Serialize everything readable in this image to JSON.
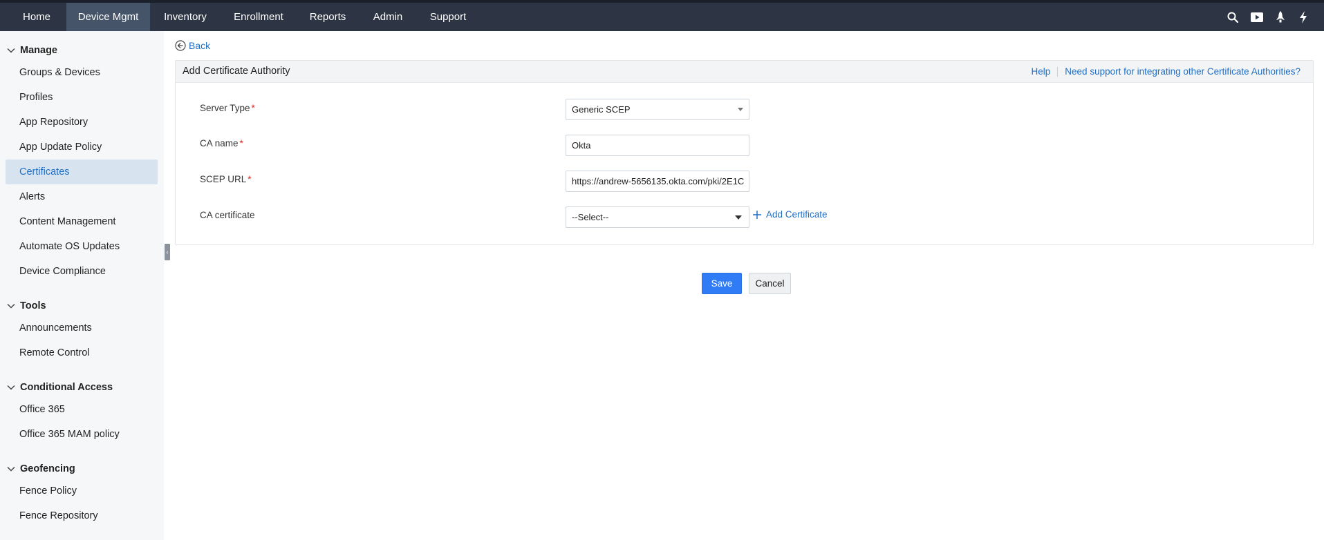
{
  "nav": {
    "tabs": [
      {
        "label": "Home"
      },
      {
        "label": "Device Mgmt"
      },
      {
        "label": "Inventory"
      },
      {
        "label": "Enrollment"
      },
      {
        "label": "Reports"
      },
      {
        "label": "Admin"
      },
      {
        "label": "Support"
      }
    ],
    "active_tab": "Device Mgmt",
    "right_icons": [
      "search-icon",
      "video-icon",
      "rocket-icon",
      "flash-icon"
    ]
  },
  "sidebar": {
    "sections": [
      {
        "title": "Manage",
        "items": [
          "Groups & Devices",
          "Profiles",
          "App Repository",
          "App Update Policy",
          "Certificates",
          "Alerts",
          "Content Management",
          "Automate OS Updates",
          "Device Compliance"
        ]
      },
      {
        "title": "Tools",
        "items": [
          "Announcements",
          "Remote Control"
        ]
      },
      {
        "title": "Conditional Access",
        "items": [
          "Office 365",
          "Office 365 MAM policy"
        ]
      },
      {
        "title": "Geofencing",
        "items": [
          "Fence Policy",
          "Fence Repository"
        ]
      }
    ],
    "active_item": "Certificates"
  },
  "back_label": "Back",
  "panel": {
    "title": "Add Certificate Authority",
    "help_link": "Help",
    "support_link": "Need support for integrating other Certificate Authorities?"
  },
  "form": {
    "server_type": {
      "label": "Server Type",
      "required_mark": "*",
      "value": "Generic SCEP"
    },
    "ca_name": {
      "label": "CA name",
      "required_mark": "*",
      "value": "Okta"
    },
    "scep_url": {
      "label": "SCEP URL",
      "required_mark": "*",
      "value": "https://andrew-5656135.okta.com/pki/2E1C"
    },
    "ca_certificate": {
      "label": "CA certificate",
      "value": "--Select--"
    },
    "add_certificate_label": "Add Certificate"
  },
  "buttons": {
    "save": "Save",
    "cancel": "Cancel"
  },
  "colors": {
    "topbar": "#2d3544",
    "active_tab": "#46546a",
    "link": "#1f6fc5",
    "primary": "#2f7cf6",
    "required": "#e02020",
    "sidebar_active": "#d7e4f0"
  }
}
